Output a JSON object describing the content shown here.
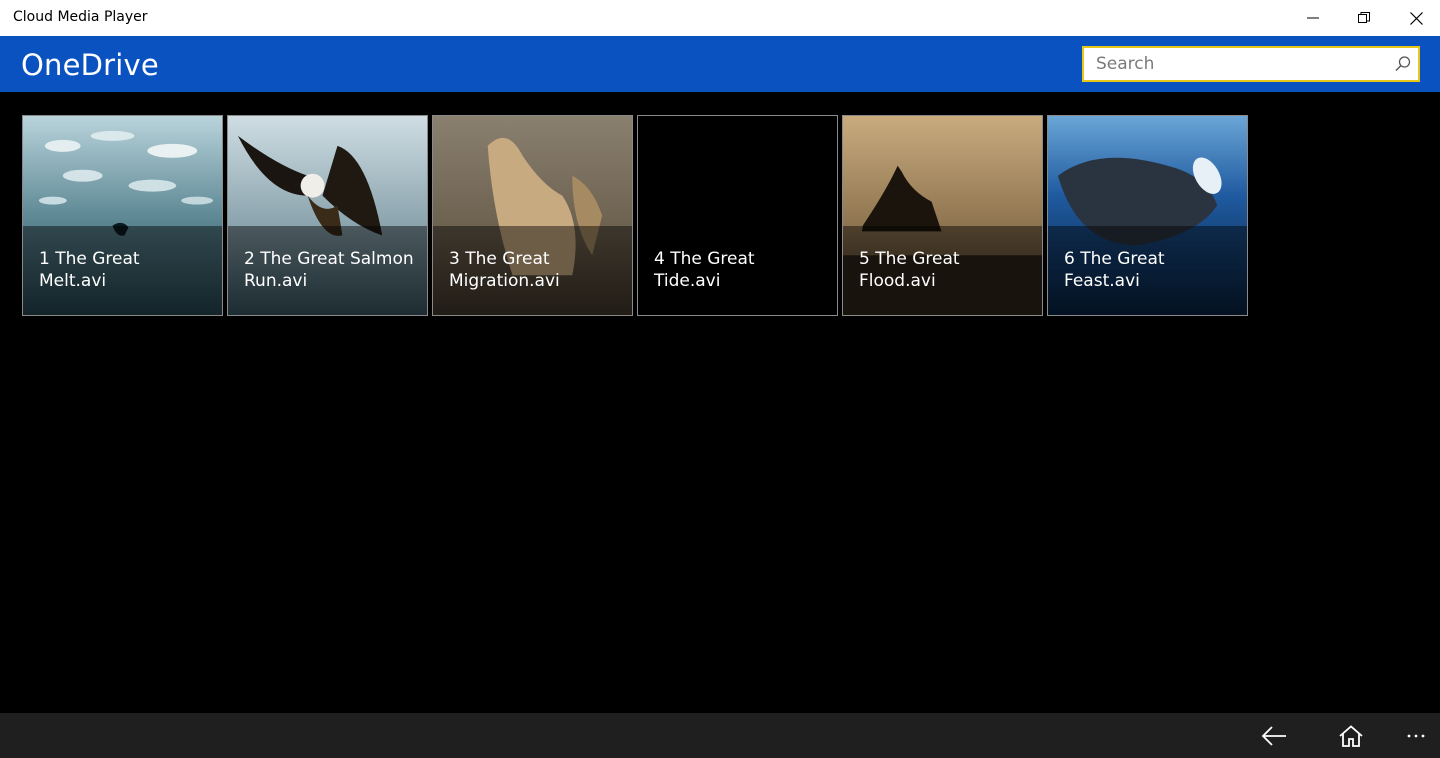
{
  "window": {
    "title": "Cloud Media Player",
    "controls": [
      "minimize-icon",
      "restore-icon",
      "close-icon"
    ]
  },
  "header": {
    "title": "OneDrive",
    "background": "#0b52c1"
  },
  "search": {
    "placeholder": "Search",
    "value": "",
    "border_color": "#e8c61a",
    "icon": "search-icon"
  },
  "videos": [
    {
      "label": "1 The Great Melt.avi"
    },
    {
      "label": "2 The Great Salmon Run.avi"
    },
    {
      "label": "3 The Great Migration.avi"
    },
    {
      "label": "4 The Great Tide.avi"
    },
    {
      "label": "5 The Great Flood.avi"
    },
    {
      "label": "6 The Great Feast.avi"
    }
  ],
  "appbar": {
    "buttons": [
      "back-arrow-icon",
      "home-icon",
      "more-options-icon"
    ]
  }
}
